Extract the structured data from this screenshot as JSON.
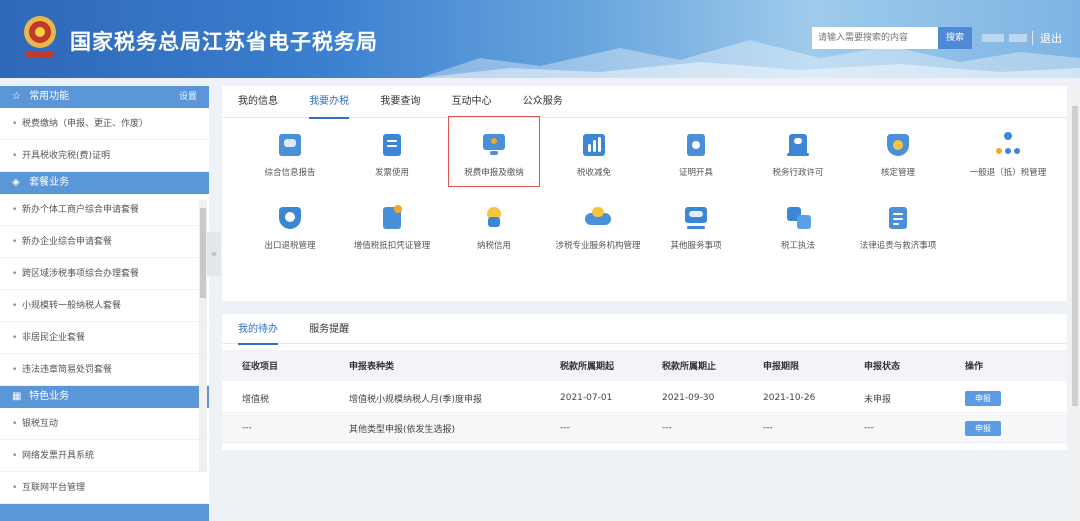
{
  "header": {
    "title": "国家税务总局江苏省电子税务局",
    "search_placeholder": "请输入需要搜索的内容",
    "search_label": "搜索",
    "logout_label": "退出",
    "colors": {
      "primary": "#2f68b8",
      "accent": "#5a96d8",
      "highlight": "#d9534f"
    }
  },
  "sidebar": {
    "common": {
      "title": "常用功能",
      "action": "设置",
      "items": [
        {
          "label": "税费缴纳（申报、更正、作废）"
        },
        {
          "label": "开具税收完税(费)证明"
        }
      ]
    },
    "packages": {
      "title": "套餐业务",
      "items": [
        {
          "label": "新办个体工商户综合申请套餐"
        },
        {
          "label": "新办企业综合申请套餐"
        },
        {
          "label": "跨区域涉税事项综合办理套餐"
        },
        {
          "label": "小规模转一般纳税人套餐"
        },
        {
          "label": "非居民企业套餐"
        },
        {
          "label": "违法违章简易处罚套餐"
        }
      ]
    },
    "special": {
      "title": "特色业务",
      "items": [
        {
          "label": "银税互动"
        },
        {
          "label": "网络发票开具系统"
        },
        {
          "label": "互联网平台管理"
        }
      ]
    }
  },
  "main": {
    "tabs": [
      {
        "label": "我的信息"
      },
      {
        "label": "我要办税"
      },
      {
        "label": "我要查询"
      },
      {
        "label": "互动中心"
      },
      {
        "label": "公众服务"
      }
    ],
    "functions": [
      {
        "label": "综合信息报告",
        "icon": "report-chart-icon"
      },
      {
        "label": "发票使用",
        "icon": "invoice-icon"
      },
      {
        "label": "税费申报及缴纳",
        "icon": "declare-monitor-icon"
      },
      {
        "label": "税收减免",
        "icon": "reduction-chart-icon"
      },
      {
        "label": "证明开具",
        "icon": "certificate-icon"
      },
      {
        "label": "税务行政许可",
        "icon": "license-icon"
      },
      {
        "label": "核定管理",
        "icon": "shield-check-icon"
      },
      {
        "label": "一般退（抵）税管理",
        "icon": "org-tree-icon"
      },
      {
        "label": "出口退税管理",
        "icon": "export-shield-icon"
      },
      {
        "label": "增值税抵扣凭证管理",
        "icon": "voucher-icon"
      },
      {
        "label": "纳税信用",
        "icon": "credit-sun-icon"
      },
      {
        "label": "涉税专业服务机构管理",
        "icon": "agency-icon"
      },
      {
        "label": "其他服务事项",
        "icon": "other-monitor-icon"
      },
      {
        "label": "税工执法",
        "icon": "law-translate-icon"
      },
      {
        "label": "法律追责与救济事项",
        "icon": "legal-doc-icon"
      }
    ]
  },
  "todo": {
    "tabs": [
      {
        "label": "我的待办"
      },
      {
        "label": "服务提醒"
      }
    ],
    "columns": [
      "征收项目",
      "申报表种类",
      "税款所属期起",
      "税款所属期止",
      "申报期限",
      "申报状态",
      "操作"
    ],
    "rows": [
      {
        "item": "增值税",
        "form": "增值税小规模纳税人月(季)度申报",
        "start": "2021-07-01",
        "end": "2021-09-30",
        "deadline": "2021-10-26",
        "status": "未申报",
        "action": "申报"
      },
      {
        "item": "---",
        "form": "其他类型申报(依发生选报)",
        "start": "---",
        "end": "---",
        "deadline": "---",
        "status": "---",
        "action": "申报"
      }
    ]
  }
}
